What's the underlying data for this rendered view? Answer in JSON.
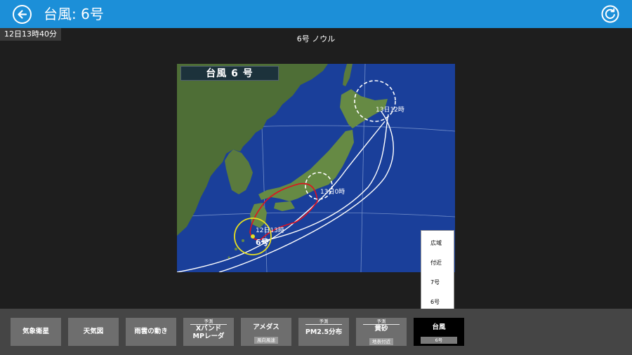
{
  "header": {
    "title": "台風: 6号"
  },
  "timestamp": "12日13時40分",
  "map": {
    "caption": "6号 ノウル",
    "title": "台風 6 号",
    "labels": {
      "forecast_13_12": "13日12時",
      "forecast_13_0": "13日0時",
      "current_time": "12日13時",
      "typhoon_no": "6号"
    }
  },
  "dropdown": {
    "items": [
      "広域",
      "付近",
      "7号",
      "6号"
    ]
  },
  "nav": [
    {
      "label": "気象衛星"
    },
    {
      "label": "天気図"
    },
    {
      "label": "雨雲の動き"
    },
    {
      "pre": "予測",
      "main": "Xバンド",
      "sub": "MPレーダ"
    },
    {
      "main": "アメダス",
      "sub": "風向風速"
    },
    {
      "pre": "予測",
      "main": "PM2.5分布"
    },
    {
      "pre": "予測",
      "main": "黄砂",
      "sub": "地表付近"
    },
    {
      "main": "台風",
      "sub": "6号"
    }
  ],
  "colors": {
    "accent": "#1c8fd8",
    "track_past": "#e01020",
    "circle_current": "#e8e020",
    "ocean": "#1a3f9a"
  }
}
